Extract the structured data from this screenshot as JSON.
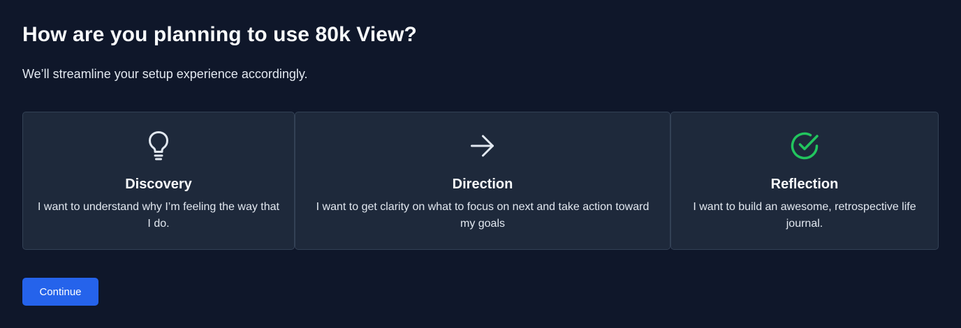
{
  "header": {
    "title": "How are you planning to use 80k View?",
    "subtitle": "We’ll streamline your setup experience accordingly."
  },
  "options": [
    {
      "icon": "lightbulb-icon",
      "title": "Discovery",
      "description": "I want to understand why I’m feeling the way that I do."
    },
    {
      "icon": "arrow-right-icon",
      "title": "Direction",
      "description": "I want to get clarity on what to focus on next and take action toward my goals"
    },
    {
      "icon": "check-circle-icon",
      "title": "Reflection",
      "description": "I want to build an awesome, retrospective life journal."
    }
  ],
  "actions": {
    "continue_label": "Continue"
  },
  "colors": {
    "background": "#0f172a",
    "card_background": "#1e293b",
    "card_border": "#334155",
    "accent_blue": "#2563eb",
    "success_green": "#22c55e"
  }
}
